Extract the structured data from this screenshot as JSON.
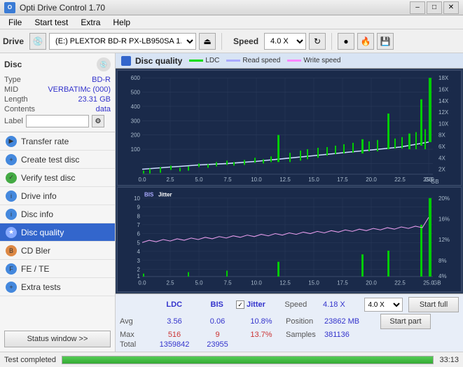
{
  "titleBar": {
    "title": "Opti Drive Control 1.70",
    "minimize": "–",
    "maximize": "□",
    "close": "✕"
  },
  "menuBar": {
    "items": [
      "File",
      "Start test",
      "Extra",
      "Help"
    ]
  },
  "toolbar": {
    "driveLabel": "Drive",
    "driveValue": "(E:) PLEXTOR BD-R  PX-LB950SA 1.06",
    "speedLabel": "Speed",
    "speedValue": "4.0 X"
  },
  "sidebar": {
    "discSection": {
      "title": "Disc",
      "fields": [
        {
          "key": "Type",
          "value": "BD-R"
        },
        {
          "key": "MID",
          "value": "VERBATIMc (000)"
        },
        {
          "key": "Length",
          "value": "23.31 GB"
        },
        {
          "key": "Contents",
          "value": "data"
        },
        {
          "key": "Label",
          "value": ""
        }
      ]
    },
    "navItems": [
      {
        "label": "Transfer rate",
        "active": false
      },
      {
        "label": "Create test disc",
        "active": false
      },
      {
        "label": "Verify test disc",
        "active": false
      },
      {
        "label": "Drive info",
        "active": false
      },
      {
        "label": "Disc info",
        "active": false
      },
      {
        "label": "Disc quality",
        "active": true
      },
      {
        "label": "CD Bler",
        "active": false
      },
      {
        "label": "FE / TE",
        "active": false
      },
      {
        "label": "Extra tests",
        "active": false
      }
    ],
    "statusBtn": "Status window >>"
  },
  "statusBar": {
    "text": "Test completed",
    "progress": 100,
    "time": "33:13"
  },
  "panel": {
    "title": "Disc quality",
    "legend": [
      {
        "label": "LDC",
        "color": "#00cc00"
      },
      {
        "label": "Read speed",
        "color": "#aaaaff"
      },
      {
        "label": "Write speed",
        "color": "#ff88ff"
      }
    ]
  },
  "chart1": {
    "yMax": 600,
    "yMin": 0,
    "xMax": 25,
    "yRight": [
      18,
      16,
      14,
      12,
      10,
      8,
      6,
      4,
      2
    ],
    "yLabels": [
      600,
      500,
      400,
      300,
      200,
      100,
      0
    ],
    "xLabels": [
      0,
      2.5,
      5.0,
      7.5,
      10.0,
      12.5,
      15.0,
      17.5,
      20.0,
      22.5,
      25.0
    ]
  },
  "chart2": {
    "title": "BIS",
    "title2": "Jitter",
    "yMax": 10,
    "yMin": 0,
    "xMax": 25,
    "yRight": [
      20,
      16,
      12,
      8,
      4
    ],
    "yLabels": [
      10,
      9,
      8,
      7,
      6,
      5,
      4,
      3,
      2,
      1
    ],
    "xLabels": [
      0,
      2.5,
      5.0,
      7.5,
      10.0,
      12.5,
      15.0,
      17.5,
      20.0,
      22.5,
      25.0
    ]
  },
  "stats": {
    "headers": [
      "LDC",
      "BIS",
      "",
      "Jitter",
      "Speed"
    ],
    "avg": {
      "ldc": "3.56",
      "bis": "0.06",
      "jitter": "10.8%"
    },
    "max": {
      "ldc": "516",
      "bis": "9",
      "jitter": "13.7%"
    },
    "total": {
      "ldc": "1359842",
      "bis": "23955"
    },
    "speed": {
      "value": "4.18 X",
      "select": "4.0 X"
    },
    "position": {
      "label": "Position",
      "value": "23862 MB"
    },
    "samples": {
      "label": "Samples",
      "value": "381136"
    },
    "startFull": "Start full",
    "startPart": "Start part"
  }
}
